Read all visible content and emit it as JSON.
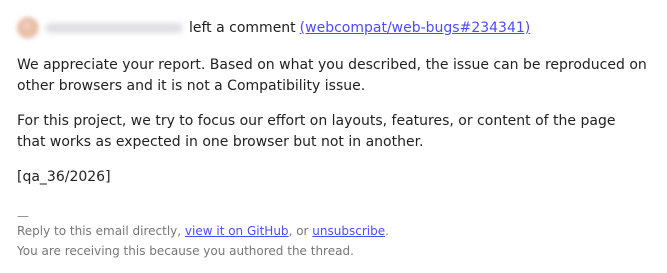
{
  "header": {
    "action_text": "left a comment",
    "issue_link": "(webcompat/web-bugs#234341)"
  },
  "body": {
    "paragraph_1": "We appreciate your report. Based on what you described, the issue can be reproduced on other browsers and it is not a Compatibility issue.",
    "paragraph_2": "For this project, we try to focus our effort on layouts, features, or content of the page that works as expected in one browser but not in another.",
    "reference": "[qa_36/2026]"
  },
  "footer": {
    "separator": "—",
    "reply_prefix": "Reply to this email directly, ",
    "github_link": "view it on GitHub",
    "or_text": ", or ",
    "unsubscribe_link": "unsubscribe",
    "period": ".",
    "reason": "You are receiving this because you authored the thread."
  },
  "colors": {
    "link": "#4c4cff",
    "text": "#222222",
    "muted": "#777777"
  },
  "icons": {
    "avatar": "user-avatar-icon"
  }
}
